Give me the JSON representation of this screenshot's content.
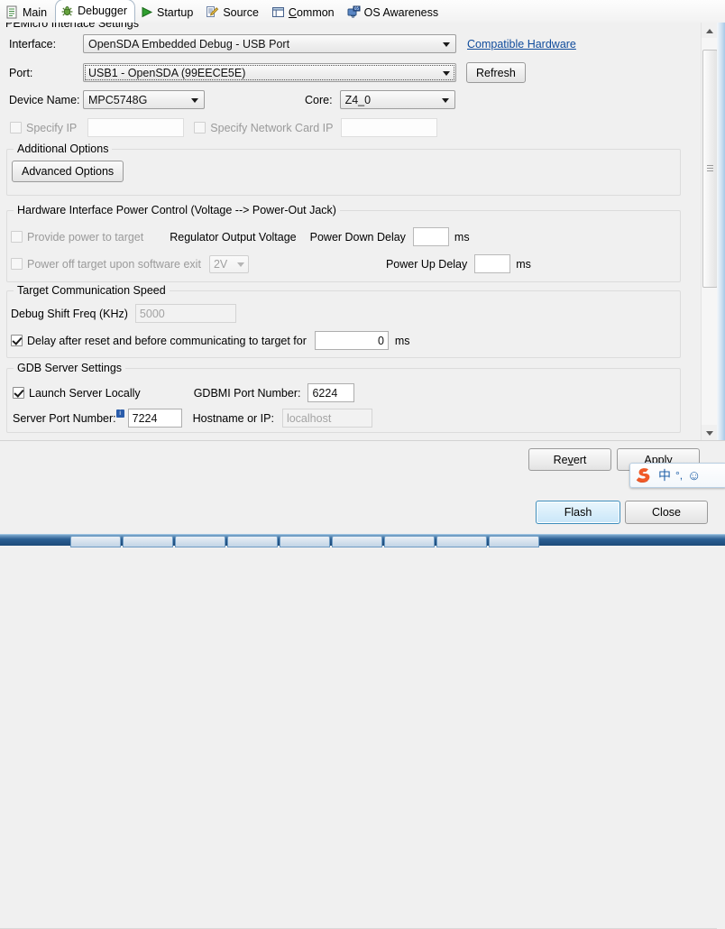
{
  "window": {
    "clipped_group_title": "PEMicro Interface Settings"
  },
  "tabs": [
    {
      "label": "Main",
      "icon": "document-icon",
      "active": false
    },
    {
      "label": "Debugger",
      "icon": "debugger-bug-icon",
      "active": true
    },
    {
      "label": "Startup",
      "icon": "play-green-icon",
      "active": false
    },
    {
      "label": "Source",
      "icon": "source-edit-icon",
      "active": false
    },
    {
      "label": "Common",
      "icon": "common-window-icon",
      "active": false
    },
    {
      "label": "OS Awareness",
      "icon": "os-monitor-icon",
      "active": false
    }
  ],
  "interface_settings": {
    "interface_label": "Interface:",
    "interface_value": "OpenSDA Embedded Debug - USB Port",
    "compatible_hardware_link": "Compatible Hardware",
    "port_label": "Port:",
    "port_value": "USB1 - OpenSDA (99EECE5E)",
    "refresh_button": "Refresh",
    "device_name_label": "Device Name:",
    "device_name_value": "MPC5748G",
    "core_label": "Core:",
    "core_value": "Z4_0",
    "specify_ip_label": "Specify IP",
    "specify_ip_checked": false,
    "specify_ip_value": "",
    "specify_network_card_ip_label": "Specify Network Card IP",
    "specify_network_card_ip_checked": false,
    "specify_network_card_ip_value": ""
  },
  "additional_options": {
    "group_title": "Additional Options",
    "advanced_options_button": "Advanced Options"
  },
  "power_control": {
    "group_title": "Hardware Interface Power Control (Voltage --> Power-Out Jack)",
    "provide_power_label": "Provide power to target",
    "provide_power_checked": false,
    "power_off_exit_label": "Power off target upon software exit",
    "power_off_exit_checked": false,
    "regulator_voltage_label": "Regulator Output Voltage",
    "regulator_voltage_value": "2V",
    "power_down_delay_label": "Power Down Delay",
    "power_down_delay_value": "",
    "power_down_delay_unit": "ms",
    "power_up_delay_label": "Power Up Delay",
    "power_up_delay_value": "",
    "power_up_delay_unit": "ms"
  },
  "comm_speed": {
    "group_title": "Target Communication Speed",
    "debug_shift_freq_label": "Debug Shift Freq (KHz)",
    "debug_shift_freq_value": "5000",
    "delay_checkbox_label": "Delay after reset and before communicating to target for",
    "delay_checked": true,
    "delay_value": "0",
    "delay_unit": "ms"
  },
  "gdb_server": {
    "group_title": "GDB Server Settings",
    "launch_server_label": "Launch Server Locally",
    "launch_server_checked": true,
    "gdbmi_port_label": "GDBMI Port Number:",
    "gdbmi_port_value": "6224",
    "server_port_label": "Server Port Number:",
    "server_port_badge": "i",
    "server_port_value": "7224",
    "hostname_label": "Hostname or IP:",
    "hostname_placeholder": "localhost",
    "hostname_value": ""
  },
  "buttons": {
    "revert": "Revert",
    "apply": "Apply",
    "flash": "Flash",
    "close": "Close"
  },
  "ime": {
    "logo": "sogou-s-logo",
    "language": "中",
    "punctuation": "°,",
    "emoji": "☺"
  },
  "colors": {
    "accent_blue": "#3c8dbc",
    "link_blue": "#0f4b9b",
    "panel_bg": "#f0f0f0",
    "default_button_fill": "#c9e6f8",
    "ime_orange": "#f05a28",
    "taskbar_blue": "#2b5f93"
  }
}
